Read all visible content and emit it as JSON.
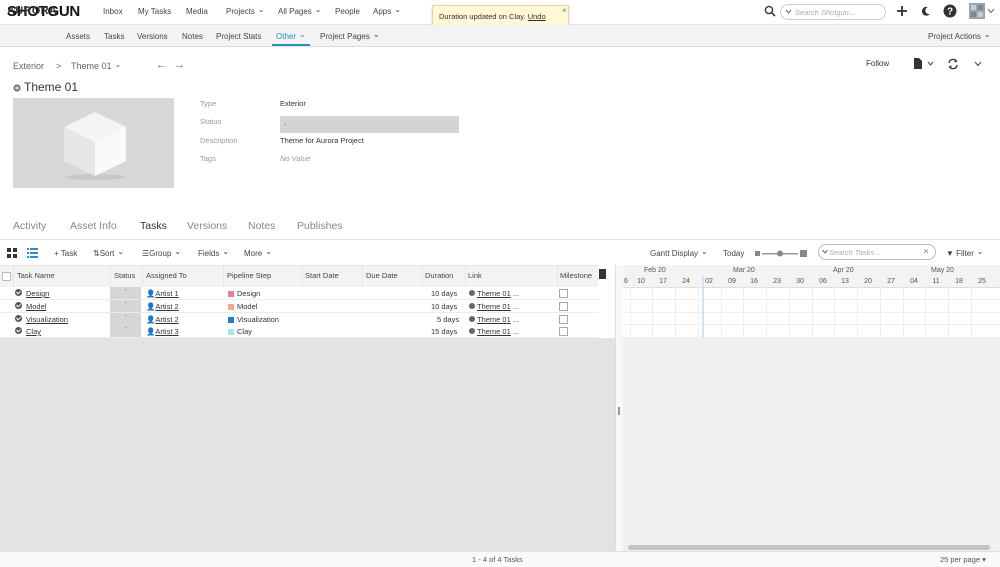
{
  "app": {
    "logo": "SHOTGUN",
    "nav": [
      "Inbox",
      "My Tasks",
      "Media",
      "Projects",
      "All Pages",
      "People",
      "Apps"
    ],
    "search_placeholder": "Search Shotgun..."
  },
  "toast": {
    "message": "Duration updated on Clay.",
    "action": "Undo",
    "close": "×"
  },
  "project": {
    "name": "AURORA",
    "nav": [
      "Assets",
      "Tasks",
      "Versions",
      "Notes",
      "Project Stats",
      "Other",
      "Project Pages"
    ],
    "actions": "Project Actions"
  },
  "breadcrumb": {
    "parent": "Exterior",
    "separator": ">",
    "current": "Theme 01",
    "back": "←",
    "forward": "→"
  },
  "header": {
    "follow": "Follow"
  },
  "entity": {
    "title": "Theme 01",
    "fields": {
      "type_label": "Type",
      "type_value": "Exterior",
      "status_label": "Status",
      "status_value": "-",
      "description_label": "Description",
      "description_value": "Theme for Aurora Project",
      "tags_label": "Tags",
      "tags_value": "No Value"
    }
  },
  "tabs": [
    "Activity",
    "Asset Info",
    "Tasks",
    "Versions",
    "Notes",
    "Publishes"
  ],
  "toolbar": {
    "add_task": "+ Task",
    "sort": "Sort",
    "group": "Group",
    "fields": "Fields",
    "more": "More",
    "gantt": "Gantt Display",
    "today": "Today",
    "search_placeholder": "Search Tasks...",
    "filter": "Filter"
  },
  "grid": {
    "columns": [
      "Task Name",
      "Status",
      "Assigned To",
      "Pipeline Step",
      "Start Date",
      "Due Date",
      "Duration",
      "Link",
      "Milestone"
    ],
    "rows": [
      {
        "task": "Design",
        "status": "-",
        "assigned": "Artist 1",
        "step": "Design",
        "step_color": "#e87ab4",
        "duration": "10 days",
        "link": "Theme 01"
      },
      {
        "task": "Model",
        "status": "-",
        "assigned": "Artist 2",
        "step": "Model",
        "step_color": "#f0a98c",
        "duration": "10 days",
        "link": "Theme 01"
      },
      {
        "task": "Visualization",
        "status": "-",
        "assigned": "Artist 2",
        "step": "Visualization",
        "step_color": "#1d7fc2",
        "duration": "5 days",
        "link": "Theme 01"
      },
      {
        "task": "Clay",
        "status": "-",
        "assigned": "Artist 3",
        "step": "Clay",
        "step_color": "#a7e2f0",
        "duration": "15 days",
        "link": "Theme 01"
      }
    ],
    "link_ellipsis": "..."
  },
  "gantt": {
    "months": [
      "Feb 20",
      "Mar 20",
      "Apr 20",
      "May 20"
    ],
    "days": [
      "6",
      "10",
      "17",
      "24",
      "02",
      "09",
      "16",
      "23",
      "30",
      "06",
      "13",
      "20",
      "27",
      "04",
      "11",
      "18",
      "25"
    ]
  },
  "footer": {
    "count": "1 - 4 of 4 Tasks",
    "per_page": "25 per page"
  }
}
